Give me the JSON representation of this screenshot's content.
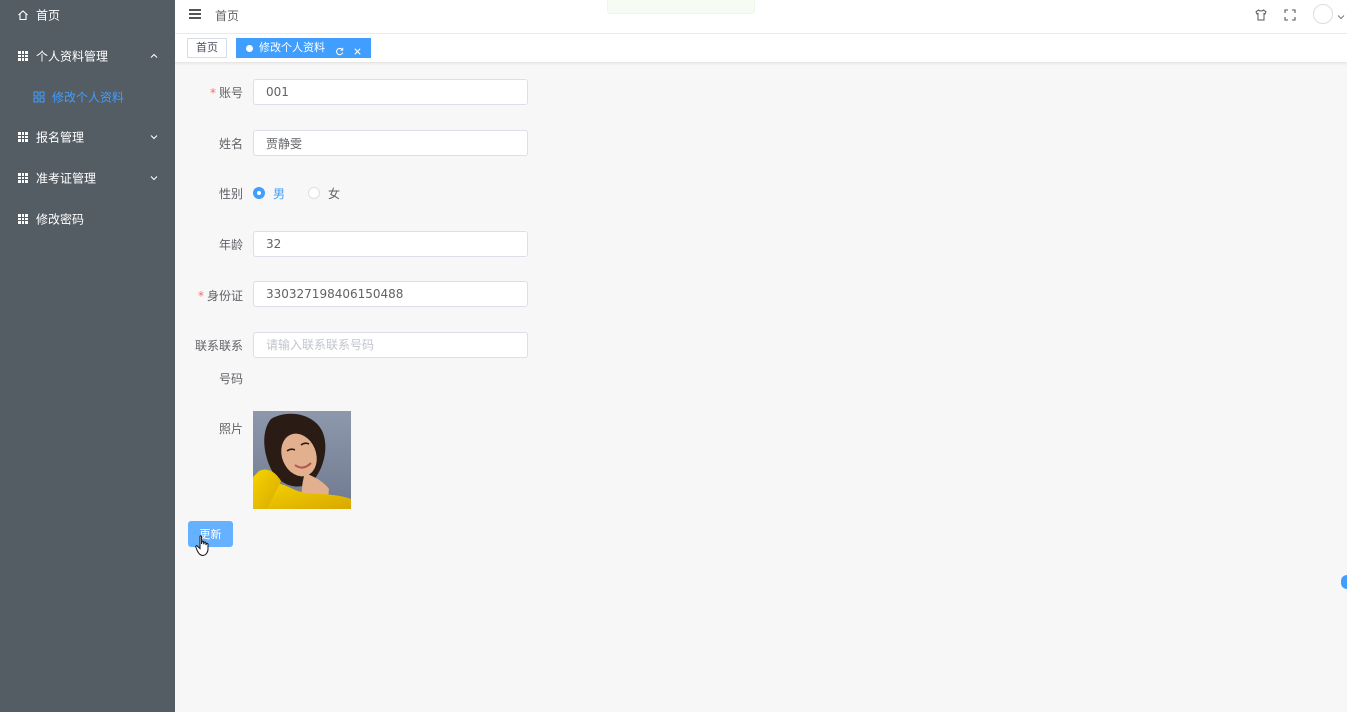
{
  "sidebar": {
    "home": "首页",
    "profile_group": "个人资料管理",
    "profile_edit": "修改个人资料",
    "signup": "报名管理",
    "admission": "准考证管理",
    "password": "修改密码"
  },
  "header": {
    "breadcrumb": "首页"
  },
  "tags": {
    "home": "首页",
    "active": "修改个人资料"
  },
  "form": {
    "account_label": "账号",
    "account_value": "001",
    "name_label": "姓名",
    "name_value": "贾静雯",
    "gender_label": "性别",
    "gender_male": "男",
    "gender_female": "女",
    "gender_selected": "男",
    "age_label": "年龄",
    "age_value": "32",
    "id_label": "身份证",
    "id_value": "330327198406150488",
    "phone_label_line1": "联系联系",
    "phone_label_line2": "号码",
    "phone_placeholder": "请输入联系联系号码",
    "photo_label": "照片",
    "update_button": "更新"
  },
  "icons": {
    "home": "home-icon",
    "menu": "grid-icon",
    "hamburger": "hamburger-icon",
    "theme": "shirt-icon",
    "fullscreen": "fullscreen-icon",
    "refresh": "refresh-icon",
    "close": "close-icon"
  },
  "colors": {
    "sidebar_bg": "#545c64",
    "accent": "#409eff",
    "required": "#f56c6c"
  }
}
